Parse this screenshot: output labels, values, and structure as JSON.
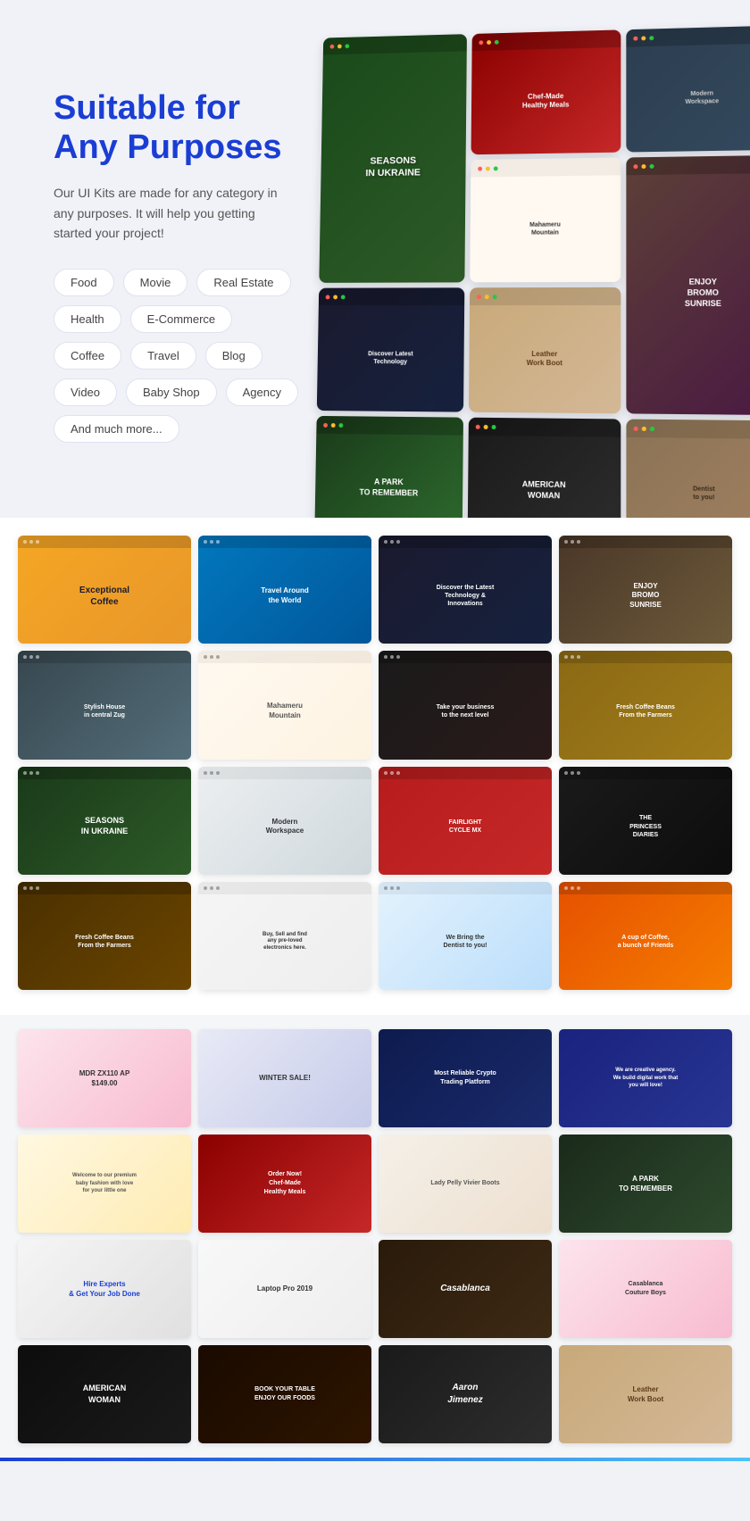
{
  "hero": {
    "title_line1": "Suitable for",
    "title_line2": "Any Purposes",
    "subtitle": "Our UI Kits are made for any category in any purposes. It will help you getting started your project!",
    "tags": [
      {
        "label": "Food"
      },
      {
        "label": "Movie"
      },
      {
        "label": "Real Estate"
      },
      {
        "label": "Health"
      },
      {
        "label": "E-Commerce"
      },
      {
        "label": "Coffee"
      },
      {
        "label": "Travel"
      },
      {
        "label": "Blog"
      },
      {
        "label": "Video"
      },
      {
        "label": "Baby Shop"
      },
      {
        "label": "Agency"
      },
      {
        "label": "And much more..."
      }
    ]
  },
  "screenshots": {
    "row1": [
      {
        "label": "Exceptional Coffee",
        "theme": "coffee-dark"
      },
      {
        "label": "Travel Around the World",
        "theme": "travel-blue"
      },
      {
        "label": "Discover the Latest Technology",
        "theme": "tech-dark"
      },
      {
        "label": "ENJOY BROMO SUNRISE",
        "theme": "nature-dark"
      }
    ],
    "row2": [
      {
        "label": "Stylish House in central Zug",
        "theme": "house-light"
      },
      {
        "label": "Mahameru Mountain",
        "theme": "mountain-light"
      },
      {
        "label": "Take your business to the next level",
        "theme": "business-dark"
      },
      {
        "label": "Fresh Coffee Beans From the Farmers",
        "theme": "coffee-tan"
      }
    ],
    "row3": [
      {
        "label": "SEASONS IN UKRAINE",
        "theme": "seasons-dark"
      },
      {
        "label": "Modern Workspace",
        "theme": "workspace-light"
      },
      {
        "label": "FAIRLIGHT CYCLE MX",
        "theme": "cycle-red"
      },
      {
        "label": "THE PRINCESS DIARIES",
        "theme": "princess-dark"
      }
    ],
    "row4": [
      {
        "label": "Fresh Coffee Beans From the Farmers",
        "theme": "coffee-warm"
      },
      {
        "label": "Buy, Sell and find any pre-loved electronics here",
        "theme": "market-light"
      },
      {
        "label": "We Bring the Dentist to you!",
        "theme": "dentist-white"
      },
      {
        "label": "A cup of Coffee, a bunch of Friends",
        "theme": "coffee-orange"
      }
    ]
  },
  "bottom_screenshots": {
    "row1": [
      {
        "label": "MDR ZX110 AP $149.00",
        "theme": "headphone-pink"
      },
      {
        "label": "WINTER SALE!",
        "theme": "winter-light"
      },
      {
        "label": "Most Reliable Crypto Trading Platform",
        "theme": "crypto-dark"
      },
      {
        "label": "We are creative agency. We build digital work that you will love!",
        "theme": "agency-dark"
      }
    ],
    "row2": [
      {
        "label": "Welcome to our premium baby fashion with love for your little one",
        "theme": "baby-cream"
      },
      {
        "label": "Order Now! Chef-Made Healthy Meals",
        "theme": "food-red"
      },
      {
        "label": "Lady Pelly Vivier Boots",
        "theme": "boots-light"
      },
      {
        "label": "A PARK TO REMEMBER",
        "theme": "park-dark"
      }
    ],
    "row3": [
      {
        "label": "Hire Experts & Get Your Job Done",
        "theme": "hire-light"
      },
      {
        "label": "Laptop Pro 2019",
        "theme": "laptop-light"
      },
      {
        "label": "Casablanca",
        "theme": "casa-dark"
      },
      {
        "label": "Casablanca Couture Boys",
        "theme": "casa-pink"
      }
    ],
    "row4": [
      {
        "label": "AMERICAN WOMAN",
        "theme": "woman-dark"
      },
      {
        "label": "BOOK YOUR TABLE ENJOY OUR FOODS",
        "theme": "food-dark"
      },
      {
        "label": "Aaron Jimenez",
        "theme": "portrait-dark"
      },
      {
        "label": "Leather Work Boot",
        "theme": "boot-cream"
      }
    ]
  }
}
